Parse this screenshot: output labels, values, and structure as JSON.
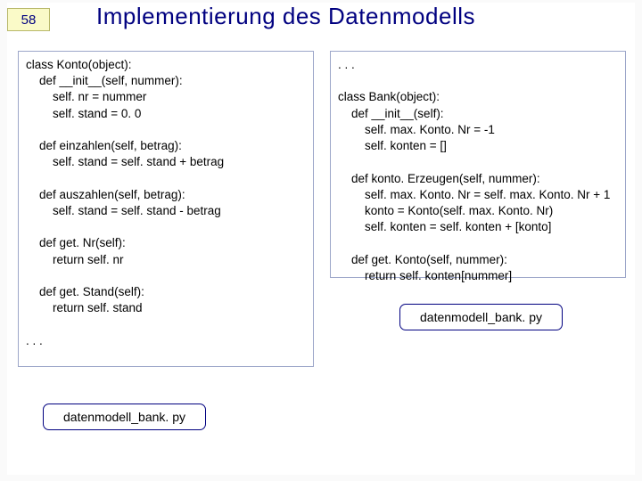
{
  "page_number": "58",
  "title": "Implementierung des Datenmodells",
  "code_left": "class Konto(object):\n    def __init__(self, nummer):\n        self. nr = nummer\n        self. stand = 0. 0\n\n    def einzahlen(self, betrag):\n        self. stand = self. stand + betrag\n\n    def auszahlen(self, betrag):\n        self. stand = self. stand - betrag\n\n    def get. Nr(self):\n        return self. nr\n\n    def get. Stand(self):\n        return self. stand\n\n. . .",
  "code_right": ". . .\n\nclass Bank(object):\n    def __init__(self):\n        self. max. Konto. Nr = -1\n        self. konten = []\n\n    def konto. Erzeugen(self, nummer):\n        self. max. Konto. Nr = self. max. Konto. Nr + 1\n        konto = Konto(self. max. Konto. Nr)\n        self. konten = self. konten + [konto]\n\n    def get. Konto(self, nummer):\n        return self. konten[nummer]",
  "file_label_right": "datenmodell_bank. py",
  "file_label_left": "datenmodell_bank. py"
}
